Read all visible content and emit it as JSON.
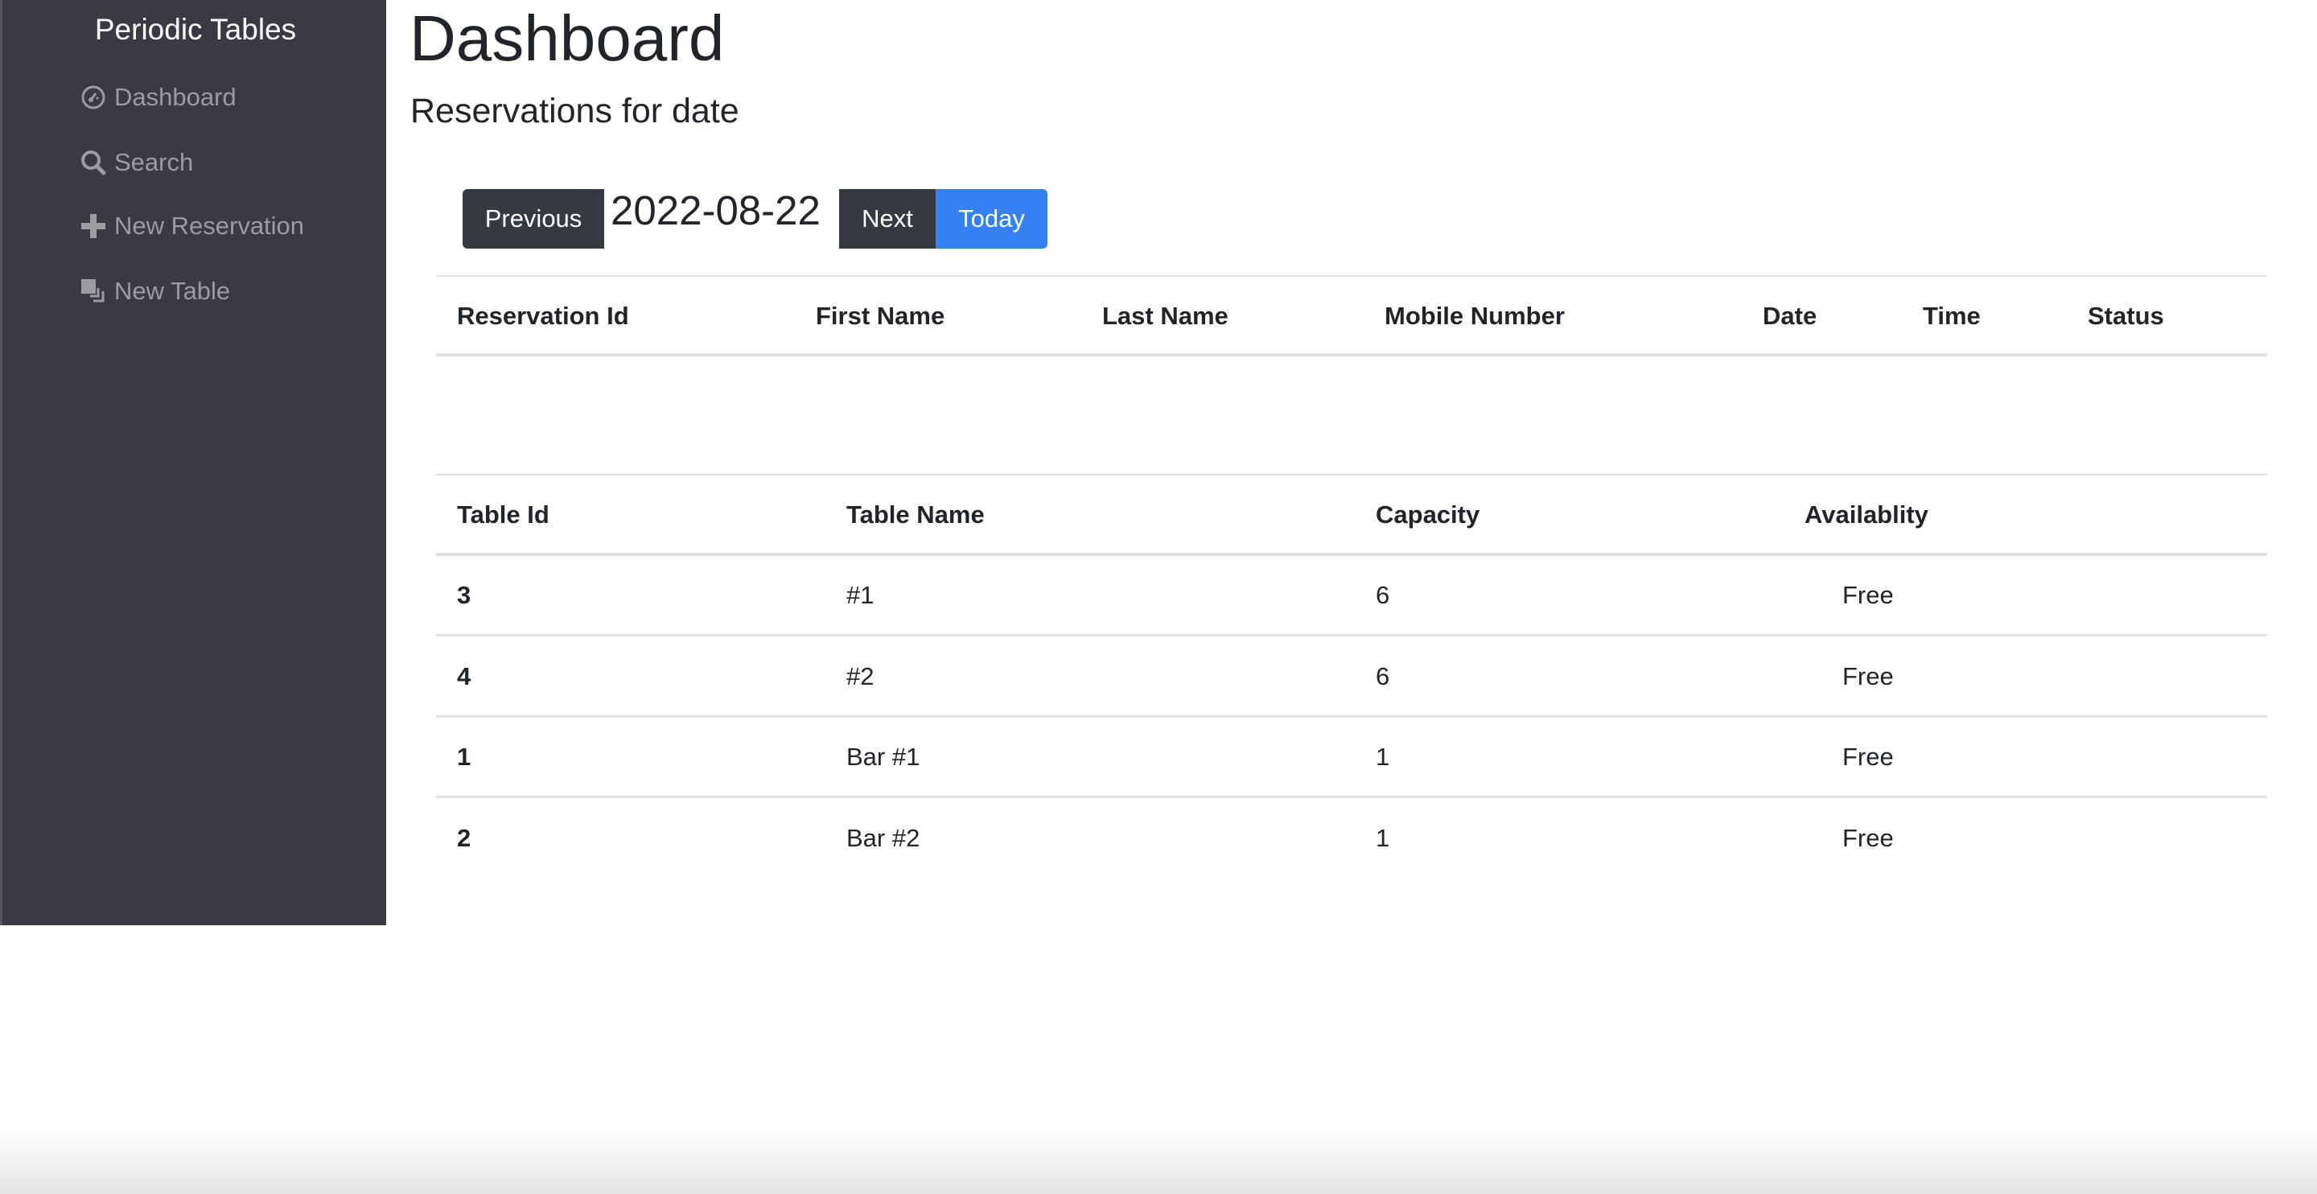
{
  "sidebar": {
    "brand": "Periodic Tables",
    "items": [
      {
        "label": "Dashboard",
        "icon": "dashboard-gauge-icon"
      },
      {
        "label": "Search",
        "icon": "search-icon"
      },
      {
        "label": "New Reservation",
        "icon": "plus-icon"
      },
      {
        "label": "New Table",
        "icon": "new-table-icon"
      }
    ]
  },
  "main": {
    "title": "Dashboard",
    "subtitle": "Reservations for date",
    "date": "2022-08-22",
    "buttons": {
      "previous": "Previous",
      "next": "Next",
      "today": "Today"
    }
  },
  "colors": {
    "sidebar": "#3a3a45",
    "dark_button": "#343a40",
    "primary": "#3381f5"
  },
  "reservations": {
    "headers": [
      "Reservation Id",
      "First Name",
      "Last Name",
      "Mobile Number",
      "Date",
      "Time",
      "Status"
    ],
    "rows": []
  },
  "tables": {
    "headers": [
      "Table Id",
      "Table Name",
      "Capacity",
      "Availablity"
    ],
    "rows": [
      {
        "id": "3",
        "name": "#1",
        "capacity": "6",
        "status": "Free"
      },
      {
        "id": "4",
        "name": "#2",
        "capacity": "6",
        "status": "Free"
      },
      {
        "id": "1",
        "name": "Bar #1",
        "capacity": "1",
        "status": "Free"
      },
      {
        "id": "2",
        "name": "Bar #2",
        "capacity": "1",
        "status": "Free"
      }
    ]
  }
}
